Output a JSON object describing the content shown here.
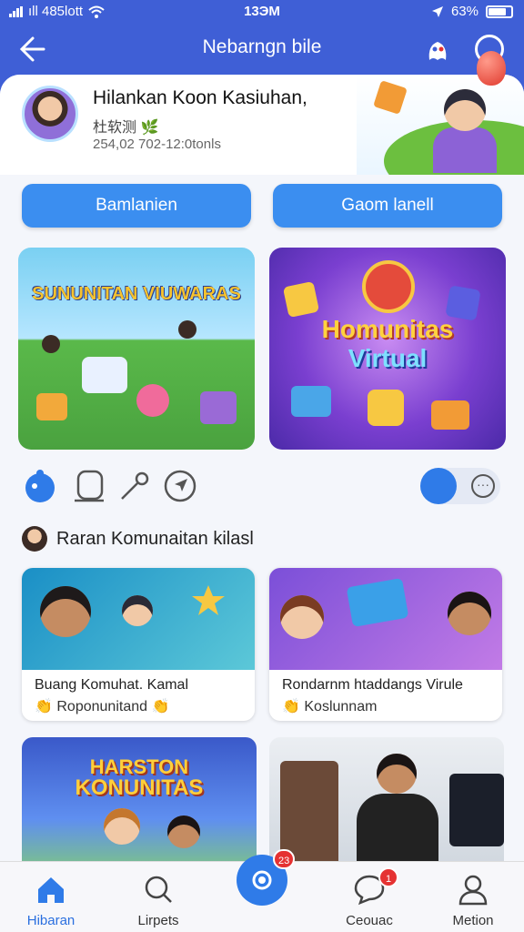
{
  "status_bar": {
    "carrier": "ıll 485lott",
    "time": "13ЭM",
    "battery": "63%"
  },
  "header": {
    "title": "Nebarngn bile"
  },
  "profile": {
    "name": "Hilankan Koon Kasiuhan,",
    "subtitle": "杜软测 🌿",
    "date": "254,02 702-12:0tonls"
  },
  "buttons": {
    "left": "Bamlanien",
    "right": "Gaom lanell"
  },
  "features": [
    {
      "title": "SUNUNITAN VIUWARAS"
    },
    {
      "title_line1": "Homunitas",
      "title_line2": "Virtual"
    }
  ],
  "section": {
    "title": "Raran Komunaitan kilasl"
  },
  "cards": [
    {
      "line1": "Buang Komuhat. Kamal",
      "line2": "👏 Roponunitand 👏"
    },
    {
      "line1": "Rondarnm htaddangs Virule",
      "line2": "👏 Koslunnam"
    }
  ],
  "big_cards": [
    {
      "title_line1": "HARSTON",
      "title_line2": "KONUNITAS"
    },
    {
      "title_line1": ""
    }
  ],
  "tabbar": {
    "tabs": [
      {
        "label": "Hibaran"
      },
      {
        "label": "Lirpets"
      },
      {
        "label": ""
      },
      {
        "label": "Ceouac"
      },
      {
        "label": "Metion"
      }
    ],
    "fab_badge": "23",
    "chat_badge": "1"
  },
  "colors": {
    "primary": "#3f5fd6",
    "accent": "#2f7be8",
    "badge": "#e53232"
  }
}
